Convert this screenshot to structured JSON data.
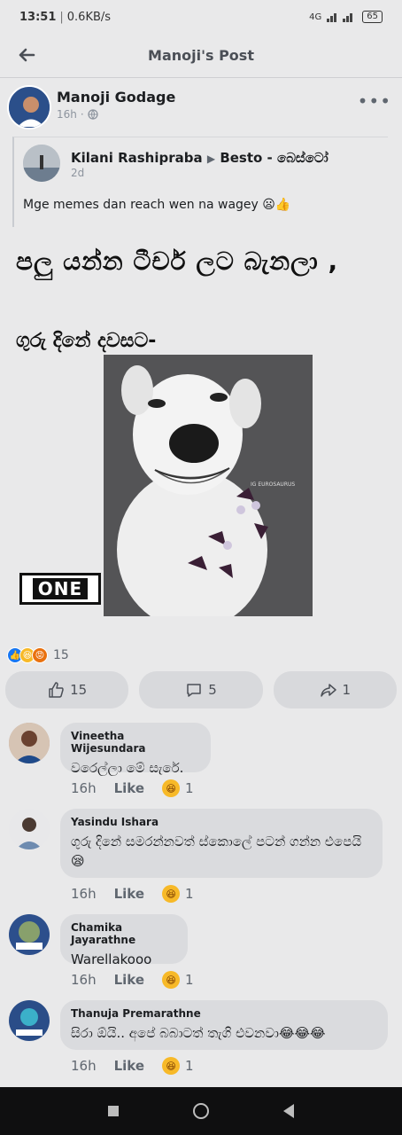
{
  "status": {
    "time": "13:51",
    "speed": "0.6KB/s",
    "signal": "4G",
    "battery": "65"
  },
  "header": {
    "title": "Manoji's Post"
  },
  "post": {
    "author": "Manoji Godage",
    "time": "16h",
    "shared": {
      "author": "Kilani Rashipraba",
      "arrow": "▶",
      "target": "Besto - බෙස්ටෝ",
      "time": "2d",
      "message": "Mge memes dan reach wen na wagey 😦👍"
    },
    "meme": {
      "line1": "පලු යන්න ටීචර් ලට බැනලා ,",
      "line2": "ගුරු දිනේ දවසට-",
      "tag": "ONE",
      "watermark": "IG EUROSAURUS"
    },
    "reactions_count": "15",
    "actions": {
      "like_count": "15",
      "comment_count": "5",
      "share_count": "1"
    }
  },
  "comments": [
    {
      "name": "Vineetha Wijesundara",
      "text": "වරෙල්ලා මේ සැරේ.",
      "time": "16h",
      "like": "Like",
      "react_count": "1"
    },
    {
      "name": "Yasindu Ishara",
      "text": "ගුරු දිනේ සමරන්නවත් ස්කොලේ පටන් ගන්න එපෙයි😪",
      "time": "16h",
      "like": "Like",
      "react_count": "1"
    },
    {
      "name": "Chamika Jayarathne",
      "text": "Warellakooo",
      "time": "16h",
      "like": "Like",
      "react_count": "1"
    },
    {
      "name": "Thanuja Premarathne",
      "text": "සිරා ඕයි.. අපේ බබාටත් තැගි එවනවා😂😂😂",
      "time": "16h",
      "like": "Like",
      "react_count": "1"
    }
  ],
  "colors": {
    "like_blue": "#1877f2",
    "haha_yellow": "#f7b928",
    "angry_orange": "#e9710f"
  }
}
